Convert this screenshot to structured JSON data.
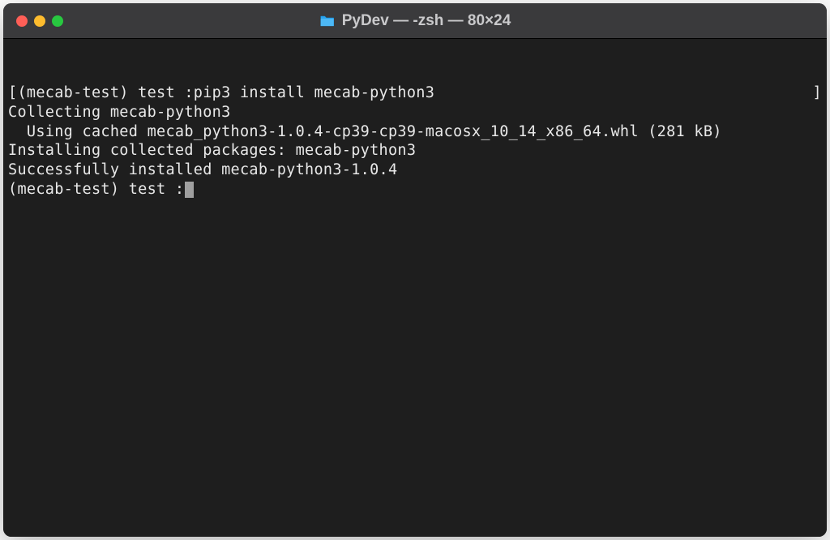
{
  "window": {
    "title": "PyDev — -zsh — 80×24"
  },
  "terminal": {
    "line1_left": "[(mecab-test) test :pip3 install mecab-python3",
    "line1_right": "]",
    "line2": "Collecting mecab-python3",
    "line3": "  Using cached mecab_python3-1.0.4-cp39-cp39-macosx_10_14_x86_64.whl (281 kB)",
    "line4": "Installing collected packages: mecab-python3",
    "line5": "Successfully installed mecab-python3-1.0.4",
    "line6": "(mecab-test) test :"
  }
}
